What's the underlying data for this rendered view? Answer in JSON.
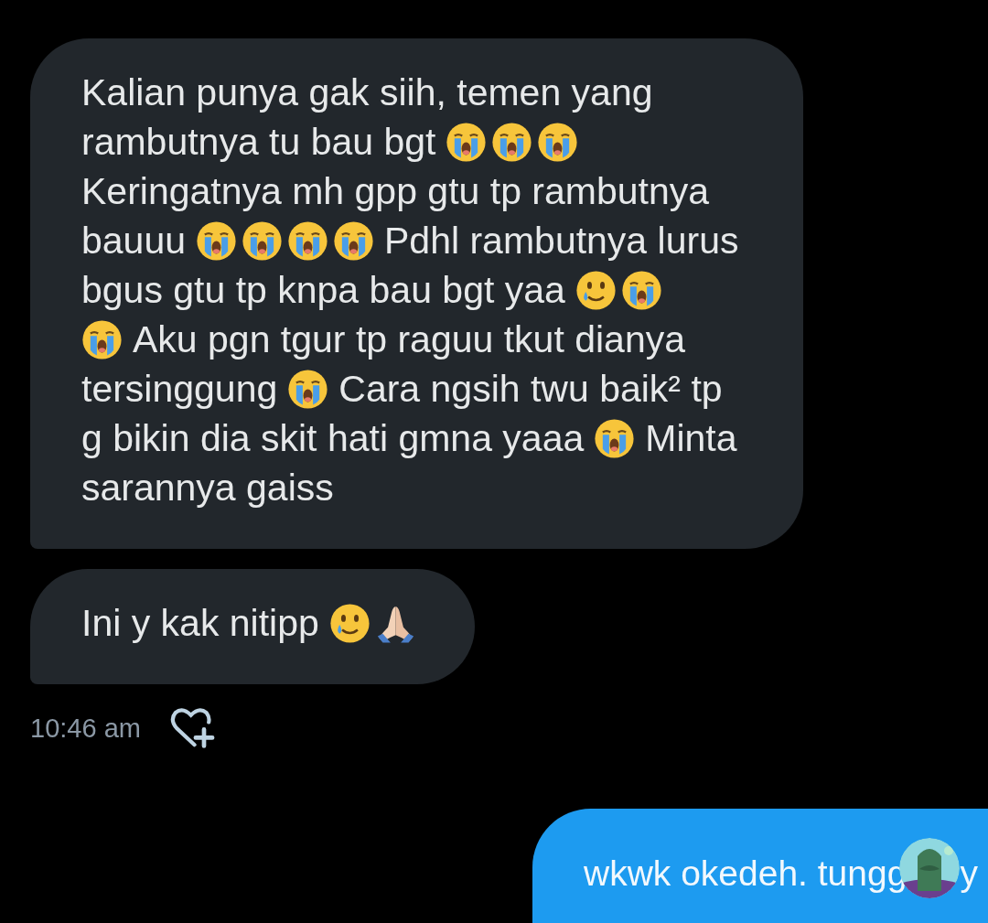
{
  "messages": [
    {
      "lines": [
        [
          {
            "kind": "text",
            "text": "Kalian punya gak siih, temen yang"
          }
        ],
        [
          {
            "kind": "text",
            "text": "rambutnya tu bau bgt"
          },
          {
            "kind": "crying"
          },
          {
            "kind": "crying"
          },
          {
            "kind": "crying"
          }
        ],
        [
          {
            "kind": "text",
            "text": "Keringatnya mh gpp gtu tp rambutnya"
          }
        ],
        [
          {
            "kind": "text",
            "text": "bauuu"
          },
          {
            "kind": "crying"
          },
          {
            "kind": "crying"
          },
          {
            "kind": "crying"
          },
          {
            "kind": "crying"
          },
          {
            "kind": "text",
            "text": "Pdhl rambutnya lurus"
          }
        ],
        [
          {
            "kind": "text",
            "text": "bgus gtu tp knpa bau bgt yaa"
          },
          {
            "kind": "teary-smile"
          },
          {
            "kind": "crying"
          }
        ],
        [
          {
            "kind": "crying"
          },
          {
            "kind": "text",
            "text": "Aku pgn tgur tp raguu tkut dianya"
          }
        ],
        [
          {
            "kind": "text",
            "text": "tersinggung"
          },
          {
            "kind": "crying"
          },
          {
            "kind": "text",
            "text": "Cara ngsih twu baik² tp"
          }
        ],
        [
          {
            "kind": "text",
            "text": "g bikin dia skit hati gmna yaaa"
          },
          {
            "kind": "crying"
          },
          {
            "kind": "text",
            "text": "Minta"
          }
        ],
        [
          {
            "kind": "text",
            "text": "sarannya gaiss"
          }
        ]
      ]
    },
    {
      "lines": [
        [
          {
            "kind": "text",
            "text": "Ini y kak nitipp"
          },
          {
            "kind": "teary-smile"
          },
          {
            "kind": "pray"
          }
        ]
      ]
    }
  ],
  "timestamp": "10:46 am",
  "sent": {
    "segments": [
      {
        "kind": "text",
        "text": "wkwk okedeh. tungg"
      },
      {
        "kind": "avatar"
      },
      {
        "kind": "text",
        "text": "y"
      }
    ]
  }
}
